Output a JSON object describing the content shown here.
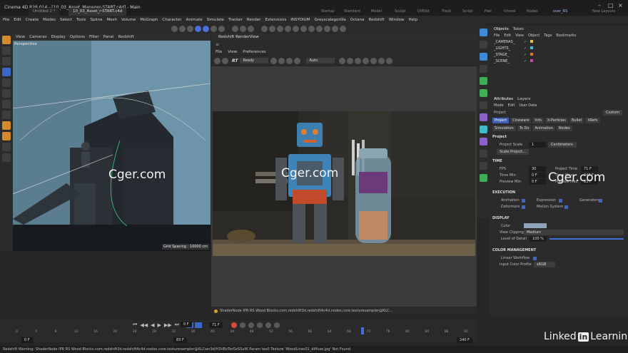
{
  "window": {
    "app_title": "Cinema 4D R26.014 - [10_03_Asset_Manager-START.c4d] - Main",
    "doc_tabs": [
      "Untitled 2 *",
      "10_03_Asset_r-START.c4d"
    ],
    "layouts": [
      "Startup",
      "Standard",
      "Model",
      "Sculpt",
      "UVEdit",
      "Track",
      "Script",
      "Hair",
      "Unreal",
      "Nodes"
    ],
    "active_layout": "over_RS",
    "new_layouts": "New Layouts"
  },
  "menubar": [
    "File",
    "Edit",
    "Create",
    "Modes",
    "Select",
    "Tools",
    "Spline",
    "Mesh",
    "Volume",
    "MoGraph",
    "Character",
    "Animate",
    "Simulate",
    "Tracker",
    "Render",
    "Extensions",
    "INSYDIUM",
    "Greyscalegorilla",
    "Octane",
    "Redshift",
    "Window",
    "Help"
  ],
  "viewport": {
    "menu": [
      "View",
      "Cameras",
      "Display",
      "Options",
      "Filter",
      "Panel",
      "Redshift"
    ],
    "label": "Perspective",
    "grid_spacing": "Grid Spacing : 10000 cm"
  },
  "renderview": {
    "tab": "Redshift RenderView",
    "menu": [
      "File",
      "View",
      "Preferences"
    ],
    "mode_label": "RT",
    "status_dropdown": "Ready",
    "auto_dropdown": "Auto",
    "status_line": "ShaderNode IPR RS Wood Blocks.com.redshift3d.redshift4c4d.nodes.core.texturesampler@KLC..."
  },
  "timeline": {
    "ticks": [
      "0",
      "4",
      "8",
      "12",
      "16",
      "20",
      "24",
      "28",
      "32",
      "36",
      "40",
      "44",
      "48",
      "52",
      "56",
      "60",
      "64",
      "68",
      "72",
      "76",
      "80",
      "84",
      "88",
      "92"
    ],
    "current_frame": "71 F",
    "start_field": "0 F",
    "end_field": "83 F",
    "min_field": "0 F",
    "max_field": "240 F",
    "playhead_fraction": 0.77
  },
  "statusbar": {
    "warning": "Redshift Warning: ShaderNode IPR RS Wood Blocks.com.redshift3d.redshift4c4d.nodes.core.texturesampler@KLCwn3d/H3VBvTorOzSSufK Param tex0 Texture 'WoodLines01_diffuse.jpg' Not Found"
  },
  "objects_panel": {
    "tabs": [
      "Objects",
      "Takes"
    ],
    "menu": [
      "File",
      "Edit",
      "View",
      "Object",
      "Tags",
      "Bookmarks"
    ],
    "items": [
      {
        "name": "_CAMERAS_",
        "color": "#e8c23a"
      },
      {
        "name": "_LIGHTS_",
        "color": "#3fbfd8"
      },
      {
        "name": "_STAGE_",
        "color": "#e07a2a"
      },
      {
        "name": "_SCENE_",
        "color": "#d83fb0"
      }
    ]
  },
  "attributes_panel": {
    "tabs": [
      "Attributes",
      "Layers"
    ],
    "menu": [
      "Mode",
      "Edit",
      "User Data"
    ],
    "object": "Project",
    "custom_dropdown": "Custom",
    "subtabs_row1": [
      "Project",
      "Cineware",
      "Info",
      "X-Particles",
      "Bullet",
      "XRefs"
    ],
    "subtabs_row2": [
      "Simulation",
      "To Do",
      "Animation",
      "Nodes"
    ],
    "section_title": "Project",
    "project_scale_label": "Project Scale",
    "project_scale_value": "1",
    "project_scale_unit": "Centimeters",
    "scale_project_button": "Scale Project...",
    "time_section": "TIME",
    "fps_label": "FPS",
    "fps_value": "30",
    "project_time_label": "Project Time",
    "project_time_value": "71 F",
    "time_min_label": "Time Min",
    "time_min_value": "0 F",
    "time_max_label": "Time Max",
    "time_max_value": "240 F",
    "preview_min_label": "Preview Min",
    "preview_min_value": "0 F",
    "preview_max_label": "Preview Max",
    "preview_max_value": "83 F",
    "execution_section": "EXECUTION",
    "animation_label": "Animation",
    "expression_label": "Expression",
    "generators_label": "Generators",
    "deformers_label": "Deformers",
    "motion_system_label": "Motion System",
    "display_section": "DISPLAY",
    "color_label": "Color",
    "view_clipping_label": "View Clipping",
    "view_clipping_value": "Medium",
    "lod_label": "Level of Detail",
    "lod_value": "100 %",
    "color_mgmt_section": "COLOR MANAGEMENT",
    "linear_workflow_label": "Linear Workflow",
    "input_profile_label": "Input Color Profile",
    "input_profile_value": "sRGB"
  },
  "watermarks": {
    "left": "Cger.com",
    "right": "Cger.com"
  },
  "brand": {
    "linked": "Linked",
    "in": "in",
    "learning": "Learning"
  }
}
